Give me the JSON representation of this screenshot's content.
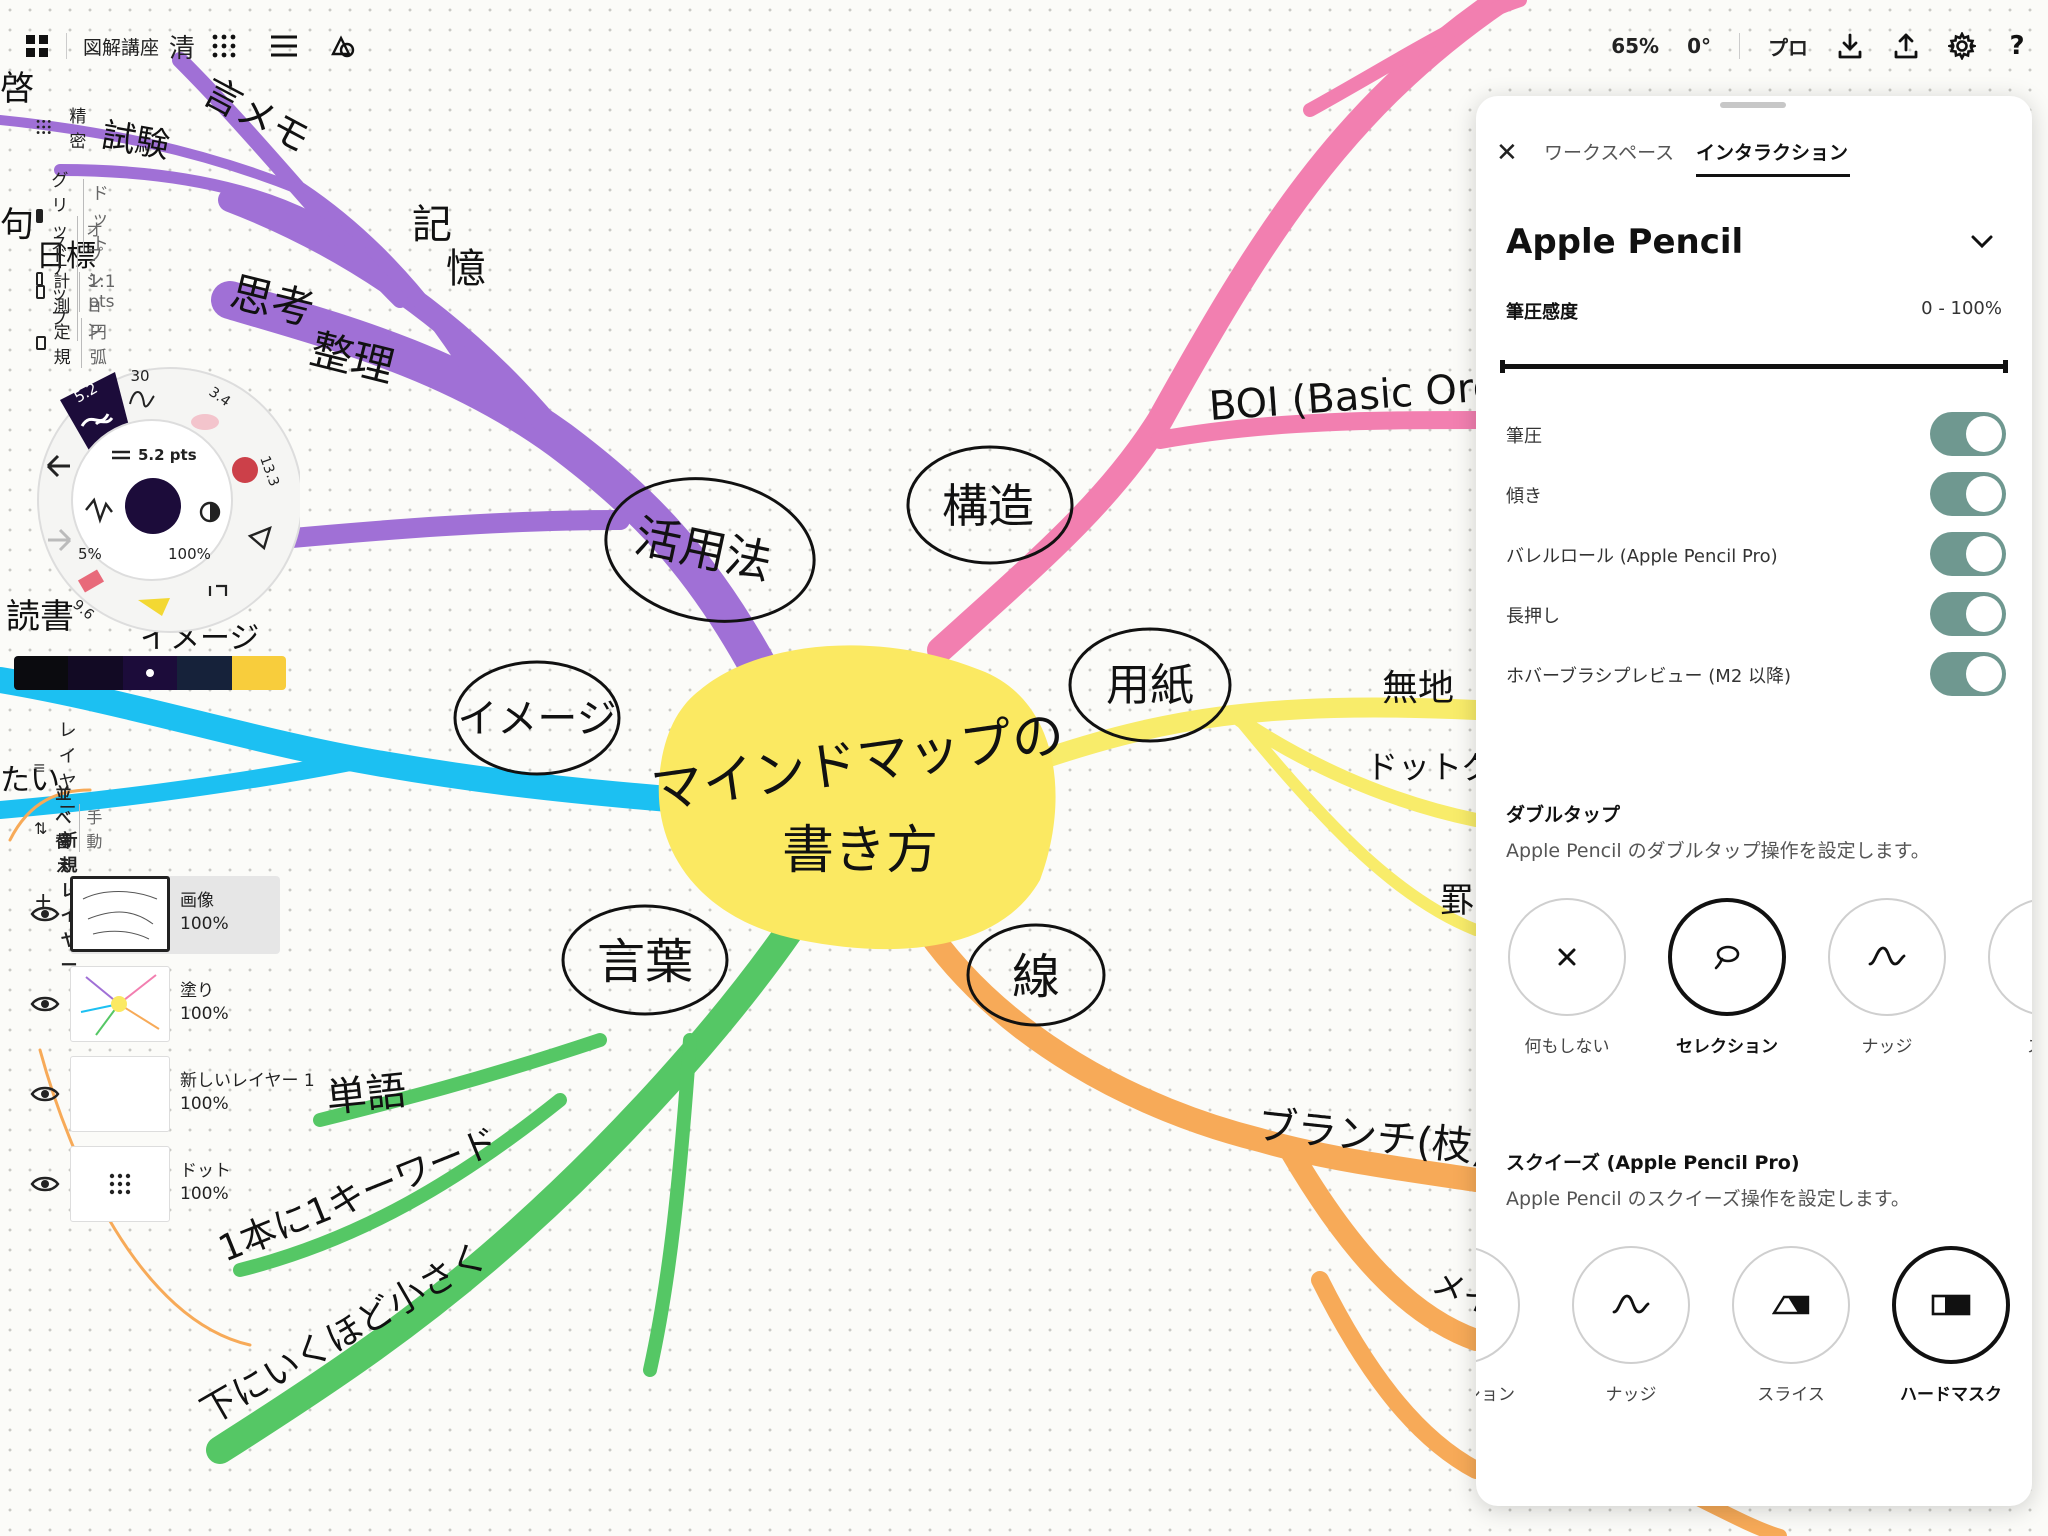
{
  "toolbar": {
    "project_title": "図解講座",
    "stray_char": "清",
    "zoom": "65%",
    "rotation": "0°",
    "pro_label": "プロ",
    "help": "?"
  },
  "precision_panel": {
    "label": "精密",
    "grid_label": "グリッド",
    "grid_value": "ドット",
    "snap_label": "スナップ",
    "snap_value": "オプション",
    "measure_label": "計測",
    "measure_value": "1:1 pts",
    "ruler_label": "定規",
    "ruler_value": "円弧"
  },
  "brush_wheel": {
    "size": "5.2 pts",
    "min_opacity": "5%",
    "max_opacity": "100%",
    "preset_1": "5.2",
    "preset_2": "30",
    "preset_3": "3.4",
    "preset_4": "13.3",
    "preset_5": "9.6",
    "current_color": "#1c0c3a"
  },
  "color_strip": [
    "#0b0b0f",
    "#120a24",
    "#1c0c3a",
    "#16223a",
    "#f8cd3c"
  ],
  "layers": {
    "title": "レイヤー",
    "sort_label": "並べ替え",
    "sort_value": "手動",
    "new_layer": "新規レイヤー",
    "items": [
      {
        "name": "画像",
        "opacity": "100%"
      },
      {
        "name": "塗り",
        "opacity": "100%"
      },
      {
        "name": "新しいレイヤー 1",
        "opacity": "100%"
      },
      {
        "name": "ドット",
        "opacity": "100%"
      }
    ]
  },
  "mindmap": {
    "center_line1": "マインドマップの",
    "center_line2": "書き方",
    "nodes": {
      "usage": "活用法",
      "structure": "構造",
      "paper": "用紙",
      "image": "イメージ",
      "words": "言葉",
      "line": "線"
    },
    "labels": {
      "memo": "言メモ",
      "memory_1": "記",
      "memory_2": "憶",
      "thinking_1": "思考",
      "thinking_2": "整理",
      "boi": "BOI (Basic Orde",
      "plain": "無地",
      "dotgrid": "ドットグリ",
      "ruled": "罫",
      "branch": "ブランチ(枝)",
      "main": "メイ",
      "word": "単語",
      "keyword": "1本に1キーワード",
      "smaller": "下にいくほど小さく",
      "edge_1": "啓",
      "edge_2": "試験",
      "edge_3": "句",
      "edge_4": "日標",
      "edge_5": "読書",
      "edge_6": "イメージ",
      "edge_7": "たい"
    },
    "colors": {
      "purple": "#a070d6",
      "pink": "#f27fb0",
      "blue": "#1cc0f2",
      "yellow_branch": "#f8ec6a",
      "green": "#55c765",
      "orange": "#f7aa58",
      "center": "#fbe962"
    }
  },
  "right_panel": {
    "tab_workspace": "ワークスペース",
    "tab_interaction": "インタラクション",
    "title": "Apple Pencil",
    "pressure_range_label": "筆圧感度",
    "pressure_range_value": "0 - 100%",
    "pressure_range": [
      0,
      100
    ],
    "toggles": [
      {
        "label": "筆圧",
        "on": true
      },
      {
        "label": "傾き",
        "on": true
      },
      {
        "label": "バレルロール (Apple Pencil Pro)",
        "on": true
      },
      {
        "label": "長押し",
        "on": true
      },
      {
        "label": "ホバーブラシプレビュー (M2 以降)",
        "on": true
      }
    ],
    "double_tap": {
      "title": "ダブルタップ",
      "desc": "Apple Pencil のダブルタップ操作を設定します。",
      "options": [
        {
          "label": "何もしない",
          "icon": "x-icon",
          "selected": false
        },
        {
          "label": "セレクション",
          "icon": "lasso-icon",
          "selected": true
        },
        {
          "label": "ナッジ",
          "icon": "nudge-icon",
          "selected": false
        },
        {
          "label": "ス",
          "icon": "partial-icon",
          "selected": false
        }
      ]
    },
    "squeeze": {
      "title": "スクイーズ (Apple Pencil Pro)",
      "desc": "Apple Pencil のスクイーズ操作を設定します。",
      "options": [
        {
          "label": "ション",
          "icon": "partial-icon",
          "selected": false
        },
        {
          "label": "ナッジ",
          "icon": "nudge-icon",
          "selected": false
        },
        {
          "label": "スライス",
          "icon": "slice-icon",
          "selected": false
        },
        {
          "label": "ハードマスク",
          "icon": "hard-mask-icon",
          "selected": true
        }
      ]
    }
  }
}
